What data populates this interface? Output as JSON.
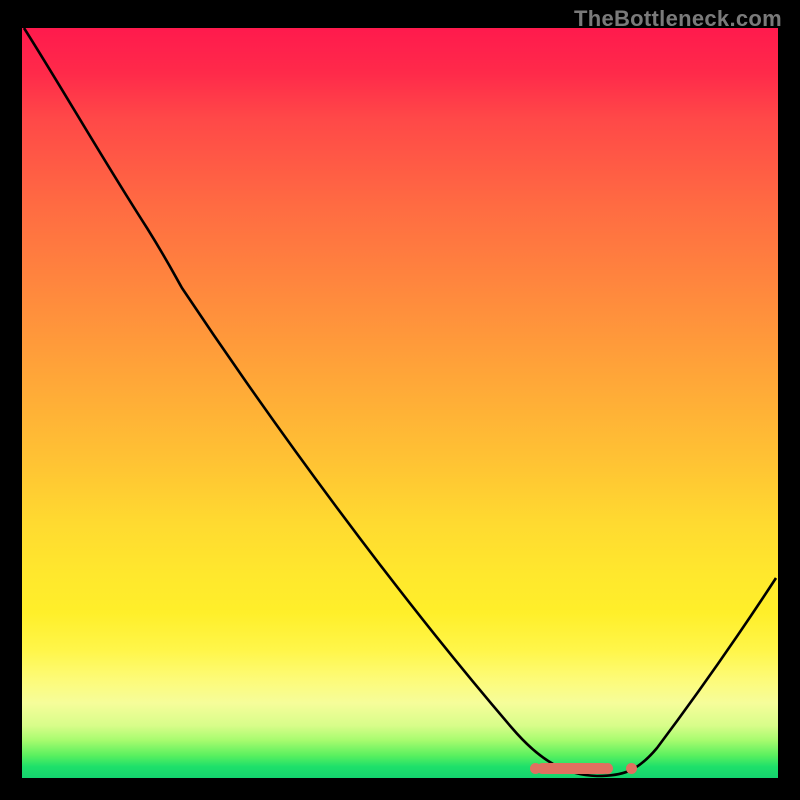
{
  "watermark": "TheBottleneck.com",
  "chart_data": {
    "type": "line",
    "title": "",
    "xlabel": "",
    "ylabel": "",
    "xlim": [
      0,
      100
    ],
    "ylim": [
      0,
      100
    ],
    "grid": false,
    "series": [
      {
        "name": "bottleneck-curve",
        "x": [
          0,
          6,
          12,
          16,
          20,
          30,
          40,
          50,
          60,
          68,
          72,
          76,
          79,
          82,
          86,
          90,
          95,
          100
        ],
        "y": [
          100,
          90,
          80,
          73,
          68,
          55,
          41,
          28,
          14,
          4,
          1,
          0,
          0,
          0,
          3,
          9,
          18,
          28
        ]
      }
    ],
    "markers": {
      "name": "optimal-cluster",
      "y": 0.2,
      "x_values": [
        69,
        70.5,
        72,
        73.5,
        75,
        76.5,
        78,
        79.5,
        83
      ]
    },
    "background_gradient": {
      "top": "#ff1a4d",
      "mid": "#ffd830",
      "bottom": "#14d36e"
    }
  }
}
